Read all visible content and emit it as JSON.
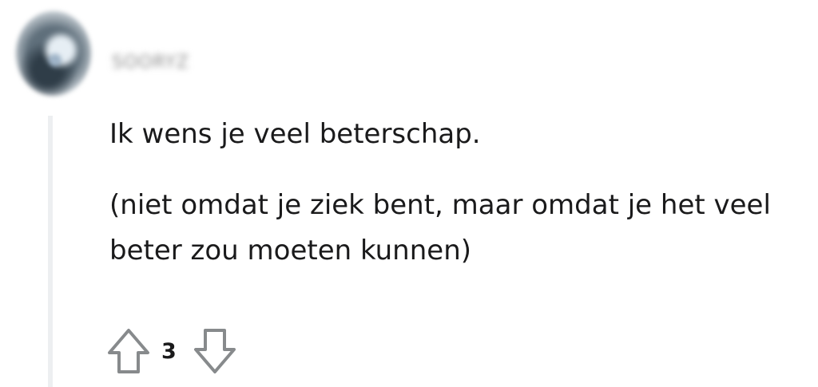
{
  "comment": {
    "author": "SOORYZ",
    "body_lines": [
      "Ik wens je veel beterschap.",
      "(niet omdat je ziek bent, maar omdat je het veel beter zou moeten kunnen)"
    ],
    "score": "3",
    "icons": {
      "upvote": "upvote-arrow-icon",
      "downvote": "downvote-arrow-icon"
    }
  }
}
